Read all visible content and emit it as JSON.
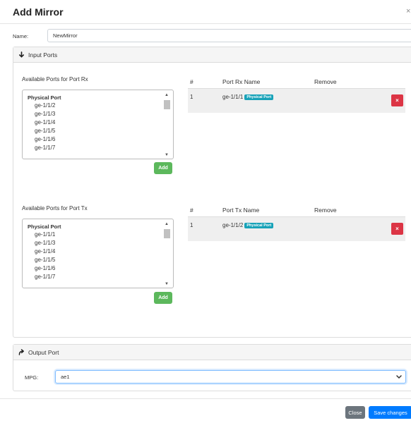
{
  "modal": {
    "title": "Add Mirror",
    "close_glyph": "×"
  },
  "name_field": {
    "label": "Name:",
    "value": "NewMirror"
  },
  "input_ports": {
    "heading": "Input Ports",
    "rx": {
      "available_label": "Available Ports for Port Rx",
      "group": "Physical Port",
      "options": [
        "ge-1/1/2",
        "ge-1/1/3",
        "ge-1/1/4",
        "ge-1/1/5",
        "ge-1/1/6",
        "ge-1/1/7"
      ],
      "add_label": "Add",
      "table_headers": {
        "num": "#",
        "name": "Port Rx Name",
        "remove": "Remove"
      },
      "rows": [
        {
          "num": "1",
          "name": "ge-1/1/1",
          "badge": "Physical Port",
          "remove_glyph": "×"
        }
      ]
    },
    "tx": {
      "available_label": "Available Ports for Port Tx",
      "group": "Physical Port",
      "options": [
        "ge-1/1/1",
        "ge-1/1/3",
        "ge-1/1/4",
        "ge-1/1/5",
        "ge-1/1/6",
        "ge-1/1/7"
      ],
      "add_label": "Add",
      "table_headers": {
        "num": "#",
        "name": "Port Tx Name",
        "remove": "Remove"
      },
      "rows": [
        {
          "num": "1",
          "name": "ge-1/1/2",
          "badge": "Physical Port",
          "remove_glyph": "×"
        }
      ]
    }
  },
  "output_port": {
    "heading": "Output Port",
    "mpg_label": "MPG:",
    "mpg_value": "ae1"
  },
  "footer": {
    "close_label": "Close",
    "save_label": "Save changes"
  },
  "colors": {
    "add": "#5cb85c",
    "remove": "#dc3545",
    "badge": "#17a2b8",
    "save": "#007bff",
    "close": "#6c757d"
  },
  "icons": {
    "input_ports": "arrow-down-icon",
    "output_port": "share-arrow-icon",
    "dropdown": "chevron-down-icon"
  }
}
